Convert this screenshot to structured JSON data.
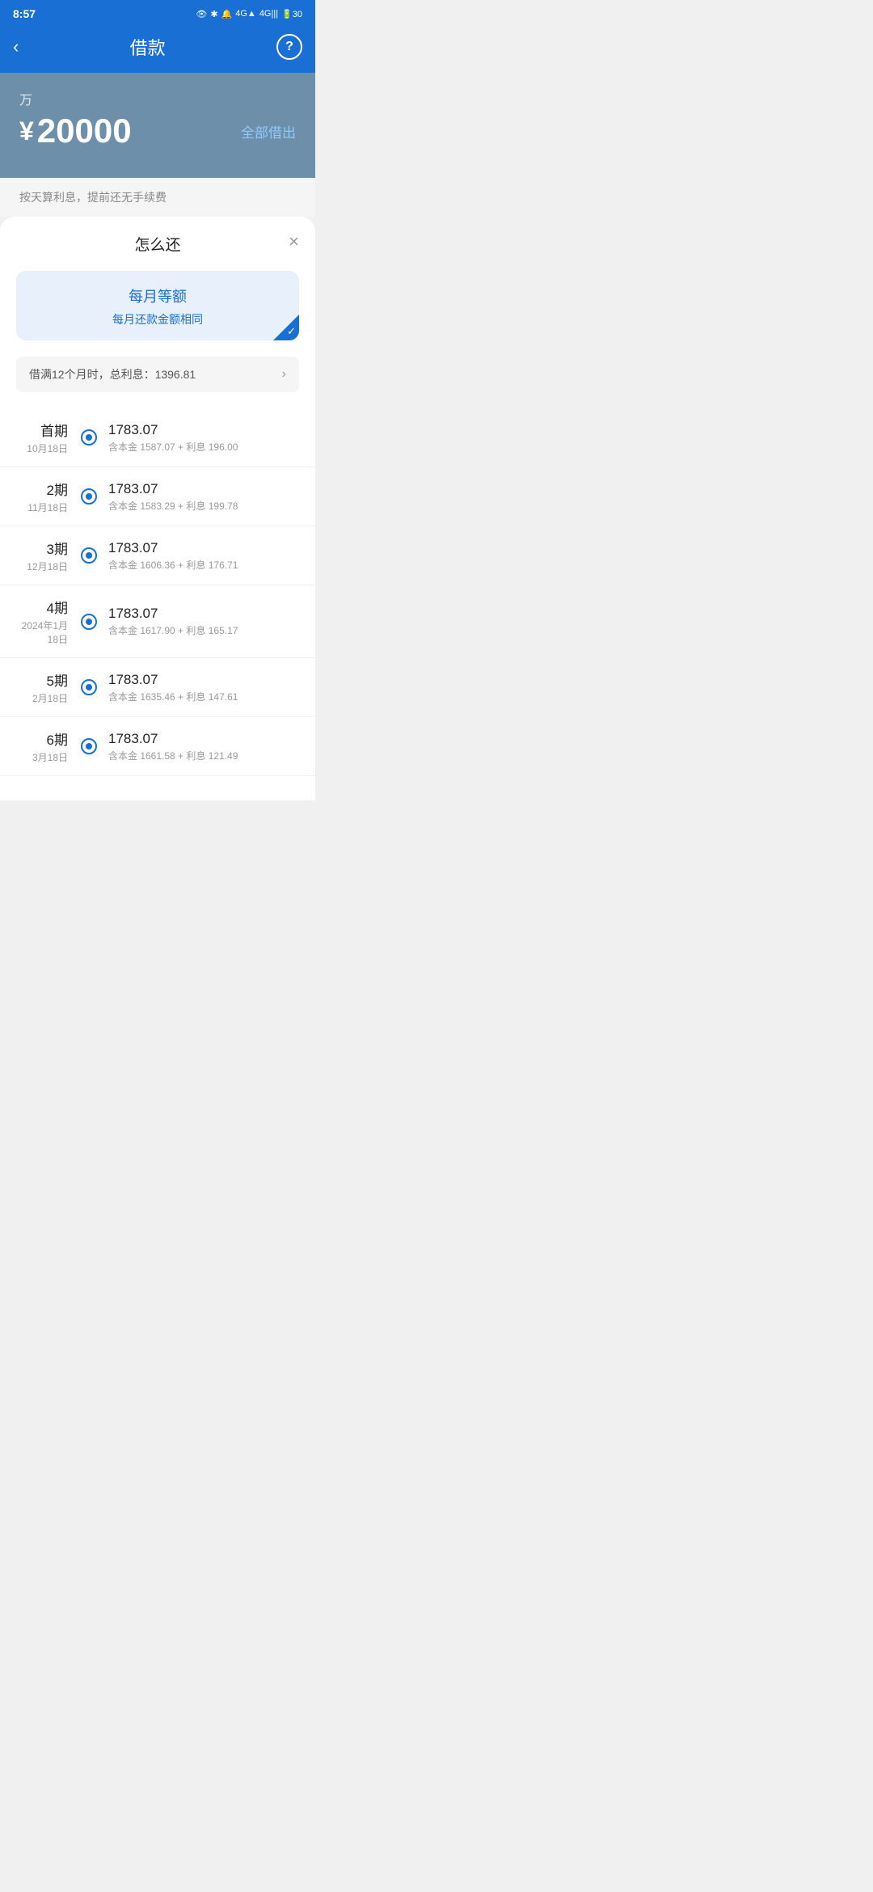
{
  "statusBar": {
    "time": "8:57"
  },
  "header": {
    "backLabel": "‹",
    "title": "借款",
    "helpLabel": "?"
  },
  "loanCard": {
    "unit": "万",
    "currencySymbol": "¥",
    "amount": "20000",
    "allOutLabel": "全部借出",
    "desc": "按天算利息，提前还无手续费"
  },
  "sheet": {
    "title": "怎么还",
    "closeLabel": "×",
    "option": {
      "title": "每月等额",
      "subtitle": "每月还款金额相同"
    },
    "infoText": "借满12个月时，总利息：1396.81",
    "infoArrow": "›"
  },
  "payments": [
    {
      "period": "首期",
      "date": "10月18日",
      "amount": "1783.07",
      "breakdown": "含本金 1587.07 + 利息 196.00"
    },
    {
      "period": "2期",
      "date": "11月18日",
      "amount": "1783.07",
      "breakdown": "含本金 1583.29 + 利息 199.78"
    },
    {
      "period": "3期",
      "date": "12月18日",
      "amount": "1783.07",
      "breakdown": "含本金 1606.36 + 利息 176.71"
    },
    {
      "period": "4期",
      "date": "2024年1月18日",
      "amount": "1783.07",
      "breakdown": "含本金 1617.90 + 利息 165.17"
    },
    {
      "period": "5期",
      "date": "2月18日",
      "amount": "1783.07",
      "breakdown": "含本金 1635.46 + 利息 147.61"
    },
    {
      "period": "6期",
      "date": "3月18日",
      "amount": "1783.07",
      "breakdown": "含本金 1661.58 + 利息 121.49"
    }
  ]
}
